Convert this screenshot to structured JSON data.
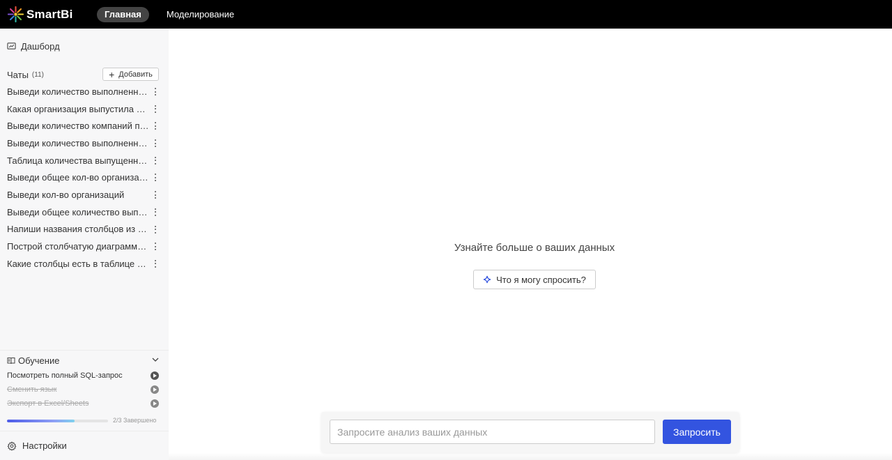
{
  "app": {
    "brand": "SmartBi"
  },
  "nav": {
    "items": [
      {
        "label": "Главная",
        "active": true
      },
      {
        "label": "Моделирование",
        "active": false
      }
    ]
  },
  "sidebar": {
    "dashboard_label": "Дашборд",
    "chats_title": "Чаты",
    "chats_count": "(11)",
    "add_label": "Добавить",
    "chats": [
      "Выведи количество выполненных заказов",
      "Какая организация выпустила наибольшее количество",
      "Выведи количество компаний по регионам",
      "Выведи количество выполненных работ",
      "Таблица количества выпущенной продукции",
      "Выведи общее кол-во организаций",
      "Выведи кол-во организаций",
      "Выведи общее количество выполненных",
      "Напиши названия столбцов из таблицы",
      "Построй столбчатую диаграмму по данным",
      "Какие столбцы есть в таблице В..."
    ],
    "learning": {
      "title": "Обучение",
      "items": [
        {
          "label": "Посмотреть полный SQL-запрос",
          "done": false
        },
        {
          "label": "Сменить язык",
          "done": true
        },
        {
          "label": "Экспорт в Excel/Sheets",
          "done": true
        }
      ],
      "progress_fraction": 0.667,
      "progress_label": "2/3 Завершено"
    },
    "settings_label": "Настройки"
  },
  "main": {
    "headline": "Узнайте больше о ваших данных",
    "ask_button": "Что я могу спросить?",
    "query_placeholder": "Запросите анализ ваших данных",
    "query_button": "Запросить"
  },
  "colors": {
    "topbar": "#000000",
    "sidebar_bg": "#f7f7f8",
    "primary_button": "#3354e0"
  }
}
